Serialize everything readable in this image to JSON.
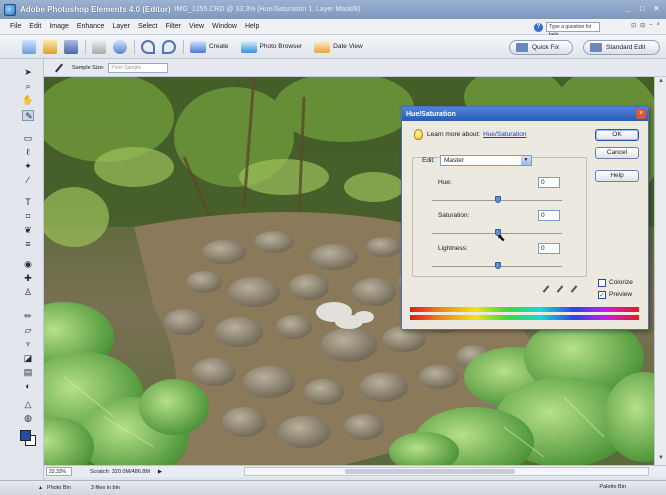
{
  "titlebar": {
    "app_title": "Adobe Photoshop Elements 4.0 (Editor)",
    "document": "IMG_1255.CRD @ 33.3% (Hue/Saturation 1, Layer Mask/8)",
    "controls": [
      "_",
      "□",
      "×"
    ]
  },
  "menubar": {
    "items": [
      "File",
      "Edit",
      "Image",
      "Enhance",
      "Layer",
      "Select",
      "Filter",
      "View",
      "Window",
      "Help"
    ],
    "help_placeholder": "Type a question for help",
    "right_controls": [
      "⊡",
      "⊟",
      "–",
      "×"
    ]
  },
  "shortcuts": {
    "create_label": "Create",
    "photo_browser_label": "Photo Browser",
    "date_view_label": "Date View",
    "quick_fix_label": "Quick Fix",
    "standard_edit_label": "Standard Edit"
  },
  "options_bar": {
    "sample_size_label": "Sample Size:",
    "sample_size_value": "Point Sample"
  },
  "status": {
    "zoom": "33.33%",
    "scratch": "Scratch: 320.0M/486.8M",
    "nav_arrow": "▶"
  },
  "photo_bin": {
    "label": "Photo Bin",
    "files": "3 files in bin",
    "palette_bin": "Palette Bin"
  },
  "dialog": {
    "title": "Hue/Saturation",
    "learn_prefix": "Learn more about:",
    "learn_link": "Hue/Saturation",
    "ok": "OK",
    "cancel": "Cancel",
    "help": "Help",
    "edit_label": "Edit:",
    "edit_value": "Master",
    "hue_label": "Hue:",
    "hue_value": "0",
    "saturation_label": "Saturation:",
    "saturation_value": "0",
    "lightness_label": "Lightness:",
    "lightness_value": "0",
    "colorize_label": "Colorize",
    "preview_label": "Preview",
    "preview_checked": true
  },
  "colors": {
    "accent": "#2b5cb4",
    "fg_swatch": "#1e4fa7",
    "bg_swatch": "#ffffff"
  }
}
